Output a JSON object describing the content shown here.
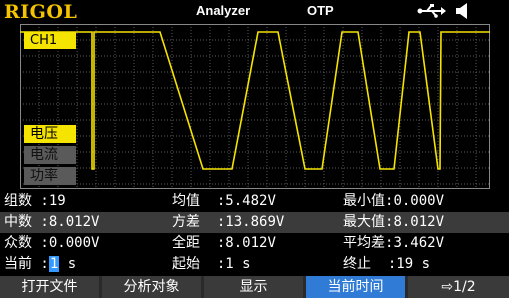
{
  "topbar": {
    "brand": "RIGOL",
    "mode": "Analyzer",
    "protection": "OTP",
    "icons": [
      "usb-icon",
      "speaker-icon"
    ]
  },
  "plot": {
    "channel_label": "CH1",
    "trace_color": "#f5e300",
    "grid_color": "#5a5a5a",
    "measure_modes": [
      "电压",
      "电流",
      "功率"
    ],
    "selected_mode": "电压"
  },
  "stats": {
    "rows": [
      [
        {
          "label": "组数",
          "value": "19"
        },
        {
          "label": "均值",
          "value": "5.482V"
        },
        {
          "label": "最小值",
          "value": "0.000V"
        }
      ],
      [
        {
          "label": "中数",
          "value": "8.012V"
        },
        {
          "label": "方差",
          "value": "13.869V"
        },
        {
          "label": "最大值",
          "value": "8.012V"
        }
      ],
      [
        {
          "label": "众数",
          "value": "0.000V"
        },
        {
          "label": "全距",
          "value": "8.012V"
        },
        {
          "label": "平均差",
          "value": "3.462V"
        }
      ],
      [
        {
          "label": "当前",
          "value": "1",
          "unit": "s"
        },
        {
          "label": "起始",
          "value": "1 s"
        },
        {
          "label": "终止",
          "value": "19 s"
        }
      ]
    ]
  },
  "softkeys": [
    {
      "label": "打开文件"
    },
    {
      "label": "分析对象"
    },
    {
      "label": "显示"
    },
    {
      "label": "当前时间",
      "active": true
    },
    {
      "label": "1/2"
    }
  ]
}
